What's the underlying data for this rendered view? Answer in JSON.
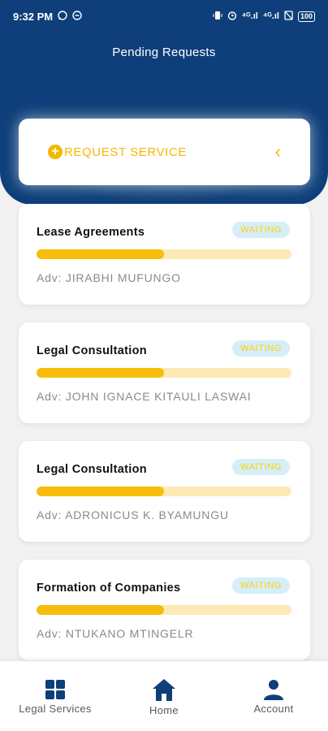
{
  "status_bar": {
    "time": "9:32 PM",
    "left_icons": [
      "whatsapp-icon",
      "minus-circle-icon"
    ],
    "right_icons": [
      "vibrate-icon",
      "alarm-icon",
      "signal-4g-icon",
      "signal-4g-icon",
      "no-sim-icon"
    ],
    "signal_label_1": "⁴ᴳ.ıl",
    "signal_label_2": "⁴ᴳ.ıl",
    "battery": "100"
  },
  "header": {
    "title": "Pending Requests"
  },
  "request_service": {
    "label": "REQUEST SERVICE",
    "plus": "+",
    "chevron": "‹"
  },
  "requests": [
    {
      "title": "Lease Agreements",
      "status": "WAITING",
      "progress": 0.5,
      "advocate": "Adv: JIRABHI MUFUNGO"
    },
    {
      "title": "Legal Consultation",
      "status": "WAITING",
      "progress": 0.5,
      "advocate": "Adv: JOHN IGNACE KITAULI LASWAI"
    },
    {
      "title": "Legal Consultation",
      "status": "WAITING",
      "progress": 0.5,
      "advocate": "Adv: ADRONICUS K. BYAMUNGU"
    },
    {
      "title": "Formation of Companies",
      "status": "WAITING",
      "progress": 0.5,
      "advocate": "Adv: NTUKANO MTINGELR"
    }
  ],
  "bottom_nav": {
    "legal_services": "Legal Services",
    "home": "Home",
    "account": "Account"
  },
  "colors": {
    "primary": "#0e3f7a",
    "accent": "#f5b800",
    "badge_bg": "#d6eef7",
    "progress_track": "#fde9b3"
  }
}
